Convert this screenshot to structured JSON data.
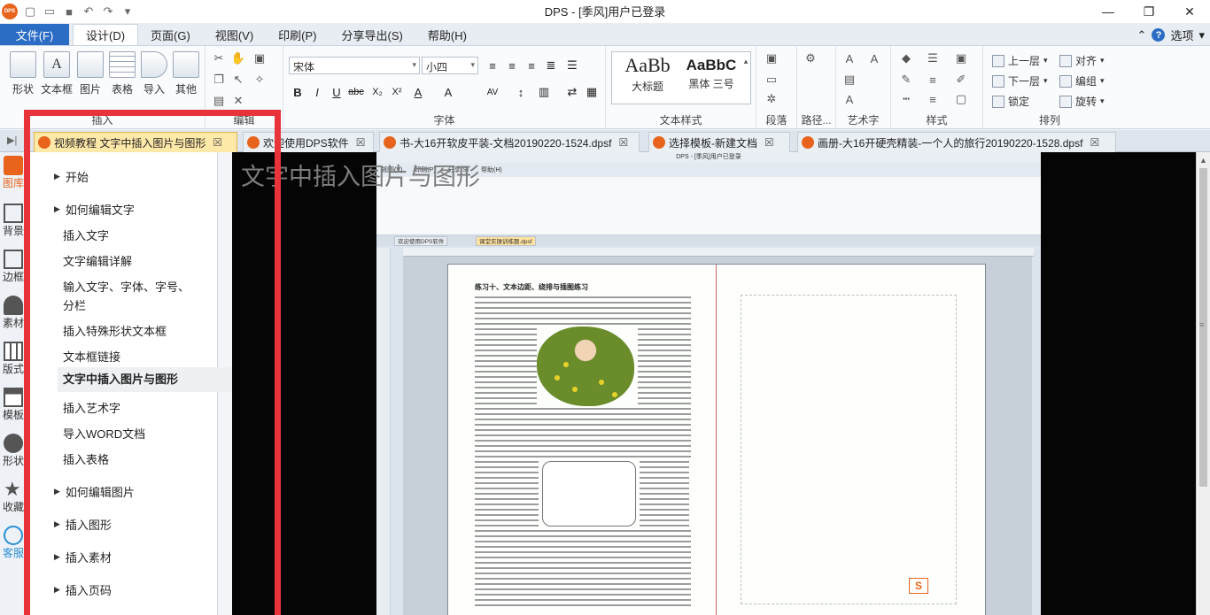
{
  "window": {
    "title": "DPS - [季风]用户已登录",
    "controls": [
      "minimize-icon",
      "restore-icon",
      "close-icon"
    ]
  },
  "quick_access": [
    "new-icon",
    "open-icon",
    "save-icon",
    "undo-icon",
    "redo-icon",
    "customize-icon"
  ],
  "menu": {
    "file": "文件(F)",
    "items": [
      "设计(D)",
      "页面(G)",
      "视图(V)",
      "印刷(P)",
      "分享导出(S)",
      "帮助(H)"
    ],
    "active_index": 0,
    "options": "选项"
  },
  "ribbon": {
    "insert_group": {
      "label": "插入",
      "buttons": [
        "形状",
        "文本框",
        "图片",
        "表格",
        "导入",
        "其他"
      ]
    },
    "edit_group": {
      "label": "编辑"
    },
    "font_group": {
      "label": "字体",
      "font_name": "宋体",
      "font_size": "小四"
    },
    "text_style_group": {
      "label": "文本样式",
      "styles": [
        {
          "preview": "AaBb",
          "name": "大标题"
        },
        {
          "preview": "AaBbC",
          "name": "黑体 三号"
        }
      ]
    },
    "paragraph_group": {
      "label": "段落"
    },
    "path_group": {
      "label": "路径..."
    },
    "art_text_group": {
      "label": "艺术字"
    },
    "style_group": {
      "label": "样式"
    },
    "arrange_group": {
      "label": "排列",
      "items": [
        "上一层",
        "对齐",
        "下一层",
        "编组",
        "锁定",
        "旋转"
      ]
    }
  },
  "tabs": [
    {
      "label": "视频教程 文字中插入图片与图形",
      "active": true
    },
    {
      "label": "欢迎使用DPS软件",
      "active": false
    },
    {
      "label": "书-大16开软皮平装-文档20190220-1524.dpsf",
      "active": false
    },
    {
      "label": "选择模板-新建文档",
      "active": false
    },
    {
      "label": "画册-大16开硬壳精装-一个人的旅行20190220-1528.dpsf",
      "active": false
    }
  ],
  "left_rail": [
    "图库",
    "背景",
    "边框",
    "素材",
    "版式",
    "模板",
    "形状",
    "收藏",
    "客服"
  ],
  "tutorial": {
    "sections": [
      {
        "title": "开始",
        "items": []
      },
      {
        "title": "如何编辑文字",
        "items": [
          "插入文字",
          "文字编辑详解",
          "输入文字、字体、字号、",
          "分栏",
          "插入特殊形状文本框",
          "文本框链接",
          "文字中插入图片与图形",
          "插入艺术字",
          "导入WORD文档",
          "插入表格"
        ]
      },
      {
        "title": "如何编辑图片",
        "items": []
      },
      {
        "title": "插入图形",
        "items": []
      },
      {
        "title": "插入素材",
        "items": []
      },
      {
        "title": "插入页码",
        "items": []
      }
    ],
    "selected": "文字中插入图片与图形"
  },
  "video": {
    "caption": "文字中插入图片与图形",
    "embedded": {
      "title": "DPS - [季风]用户已登录",
      "menu": [
        "视图(V)",
        "印刷(P)",
        "分享(S)",
        "帮助(H)"
      ],
      "tabs": [
        "欢迎使用DPS软件",
        "课堂实操训练题.dpsf"
      ],
      "page_heading": "练习十、文本边距、绕排与插图练习",
      "s_badge": "S"
    }
  },
  "colors": {
    "accent": "#2b6cc4",
    "highlight_frame": "#e8333a",
    "active_tab": "#ffe9a8",
    "logo": "#e8641c"
  }
}
